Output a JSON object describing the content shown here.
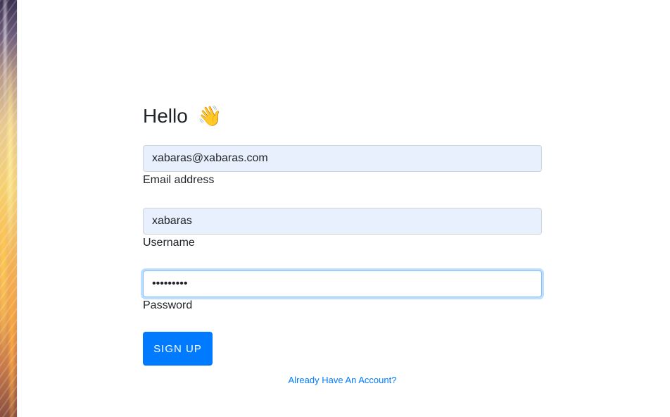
{
  "heading": {
    "text": "Hello",
    "emoji": "👋",
    "emoji_icon": "waving-hand-icon"
  },
  "form": {
    "email": {
      "value": "xabaras@xabaras.com",
      "label": "Email address"
    },
    "username": {
      "value": "xabaras",
      "label": "Username"
    },
    "password": {
      "value": "•••••••••",
      "label": "Password"
    },
    "submit_label": "SIGN UP"
  },
  "footer": {
    "link_text": "Already Have An Account?"
  },
  "colors": {
    "primary": "#007bff",
    "autofill_bg": "#e8f0fe",
    "focus_border": "#80bdff",
    "text": "#212529"
  }
}
